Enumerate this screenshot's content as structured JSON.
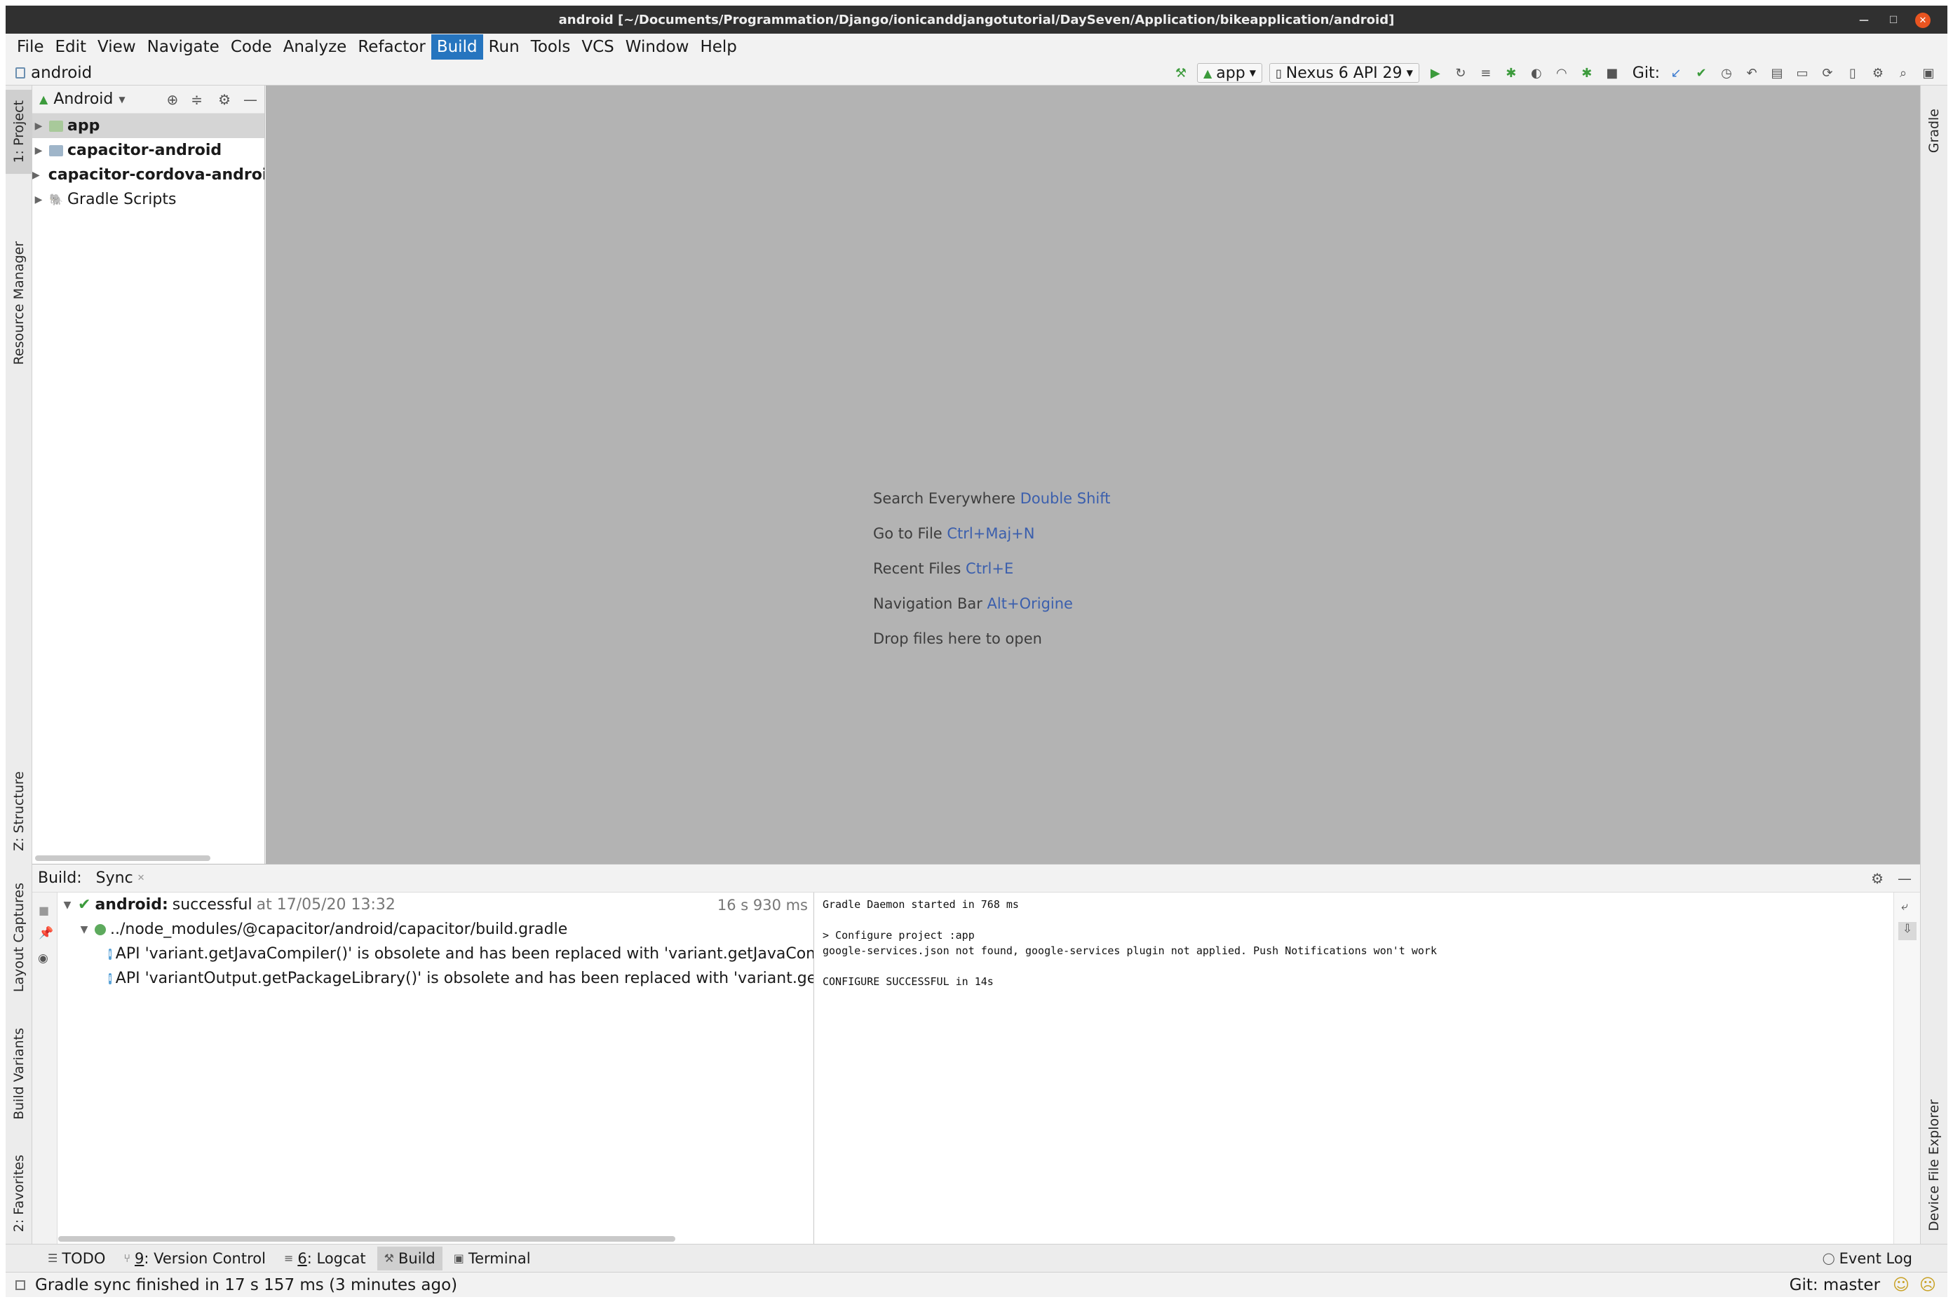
{
  "window": {
    "title": "android [~/Documents/Programmation/Django/ionicanddjangotutorial/DaySeven/Application/bikeapplication/android]"
  },
  "menu": [
    "File",
    "Edit",
    "View",
    "Navigate",
    "Code",
    "Analyze",
    "Refactor",
    "Build",
    "Run",
    "Tools",
    "VCS",
    "Window",
    "Help"
  ],
  "menu_active": "Build",
  "navbar": {
    "crumb": "android",
    "run_config": "app",
    "device": "Nexus 6 API 29",
    "git_label": "Git:"
  },
  "left_stripe": {
    "project": "1: Project",
    "resource_manager": "Resource Manager",
    "structure": "Z: Structure",
    "layout_captures": "Layout Captures",
    "build_variants": "Build Variants",
    "favorites": "2: Favorites"
  },
  "right_stripe": {
    "gradle": "Gradle",
    "device_file_explorer": "Device File Explorer"
  },
  "project_panel": {
    "view_mode": "Android",
    "items": [
      {
        "label": "app",
        "bold": true
      },
      {
        "label": "capacitor-android",
        "bold": true
      },
      {
        "label": "capacitor-cordova-android-plugins",
        "bold": true
      },
      {
        "label": "Gradle Scripts",
        "bold": false
      }
    ]
  },
  "editor_hints": [
    {
      "text": "Search Everywhere",
      "key": "Double Shift"
    },
    {
      "text": "Go to File",
      "key": "Ctrl+Maj+N"
    },
    {
      "text": "Recent Files",
      "key": "Ctrl+E"
    },
    {
      "text": "Navigation Bar",
      "key": "Alt+Origine"
    },
    {
      "text": "Drop files here to open",
      "key": ""
    }
  ],
  "build_panel": {
    "title": "Build:",
    "tab": "Sync",
    "root_name": "android:",
    "root_status": "successful",
    "root_time": "at 17/05/20 13:32",
    "root_duration": "16 s 930 ms",
    "gradle_file": "../node_modules/@capacitor/android/capacitor/build.gradle",
    "warnings": [
      "API 'variant.getJavaCompiler()' is obsolete and has been replaced with 'variant.getJavaCompileProvider()'.",
      "API 'variantOutput.getPackageLibrary()' is obsolete and has been replaced with 'variant.getPackageLibraryProvider()'."
    ],
    "console": "Gradle Daemon started in 768 ms\n\n> Configure project :app\ngoogle-services.json not found, google-services plugin not applied. Push Notifications won't work\n\nCONFIGURE SUCCESSFUL in 14s"
  },
  "tool_windows": [
    {
      "label": "TODO",
      "mnemonic": "",
      "active": false
    },
    {
      "label": ": Version Control",
      "mnemonic": "9",
      "active": false
    },
    {
      "label": ": Logcat",
      "mnemonic": "6",
      "active": false
    },
    {
      "label": "Build",
      "mnemonic": "",
      "active": true
    },
    {
      "label": "Terminal",
      "mnemonic": "",
      "active": false
    }
  ],
  "event_log": "Event Log",
  "status": {
    "message": "Gradle sync finished in 17 s 157 ms (3 minutes ago)",
    "git_branch": "Git: master"
  }
}
